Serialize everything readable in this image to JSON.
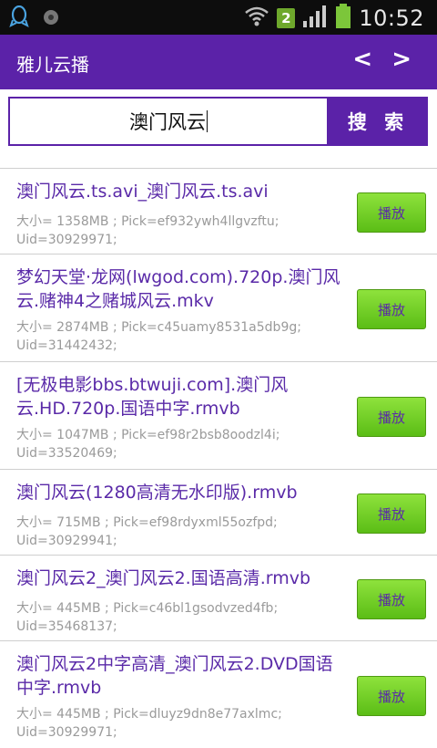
{
  "status_bar": {
    "sim_badge": "2",
    "time": "10:52"
  },
  "app_bar": {
    "title": "雅儿云播",
    "nav": "< >"
  },
  "search": {
    "query": "澳门风云",
    "button_label": "搜 索"
  },
  "results": [
    {
      "title": "澳门风云.ts.avi_澳门风云.ts.avi",
      "meta": "大小= 1358MB ; Pick=ef932ywh4llgvzftu; Uid=30929971;",
      "play_label": "播放"
    },
    {
      "title": "梦幻天堂·龙网(lwgod.com).720p.澳门风云.赌神4之赌城风云.mkv",
      "meta": "大小= 2874MB ; Pick=c45uamy8531a5db9g; Uid=31442432;",
      "play_label": "播放"
    },
    {
      "title": "[无极电影bbs.btwuji.com].澳门风云.HD.720p.国语中字.rmvb",
      "meta": "大小= 1047MB ; Pick=ef98r2bsb8oodzl4i; Uid=33520469;",
      "play_label": "播放"
    },
    {
      "title": "澳门风云(1280高清无水印版).rmvb",
      "meta": "大小= 715MB ; Pick=ef98rdyxml55ozfpd; Uid=30929941;",
      "play_label": "播放"
    },
    {
      "title": "澳门风云2_澳门风云2.国语高清.rmvb",
      "meta": "大小= 445MB ; Pick=c46bl1gsodvzed4fb; Uid=35468137;",
      "play_label": "播放"
    },
    {
      "title": "澳门风云2中字高清_澳门风云2.DVD国语中字.rmvb",
      "meta": "大小= 445MB ; Pick=dluyz9dn8e77axlmc; Uid=30929971;",
      "play_label": "播放"
    }
  ]
}
